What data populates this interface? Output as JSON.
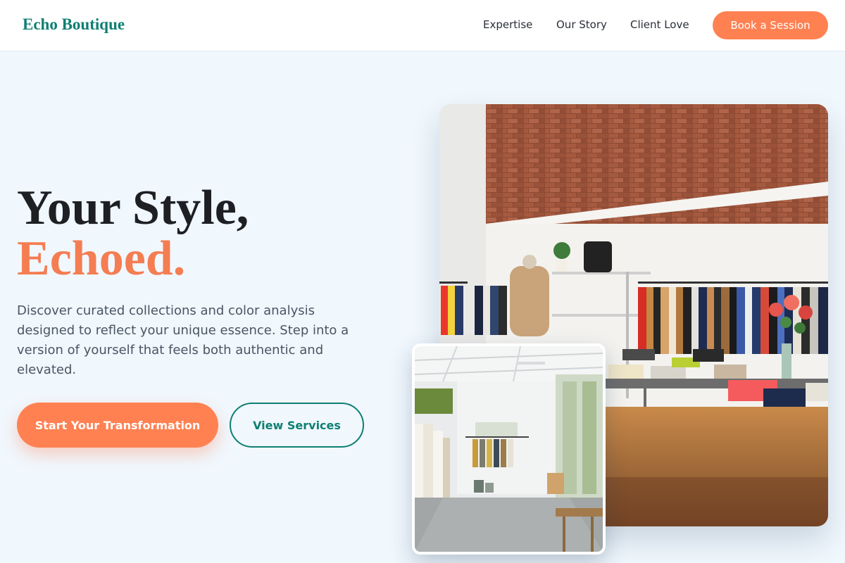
{
  "header": {
    "logo": "Echo Boutique",
    "nav": [
      "Expertise",
      "Our Story",
      "Client Love"
    ],
    "cta": "Book a Session"
  },
  "hero": {
    "title_line1": "Your Style,",
    "title_line2": "Echoed.",
    "description": "Discover curated collections and color analysis designed to reflect your unique essence. Step into a version of yourself that feels both authentic and elevated.",
    "primary_button": "Start Your Transformation",
    "secondary_button": "View Services"
  },
  "images": {
    "main_photo": "boutique-interior-photo",
    "secondary_photo": "bright-showroom-photo"
  },
  "colors": {
    "brand": "#0f7f72",
    "accent": "#ff8152",
    "background": "#f0f7fd"
  }
}
